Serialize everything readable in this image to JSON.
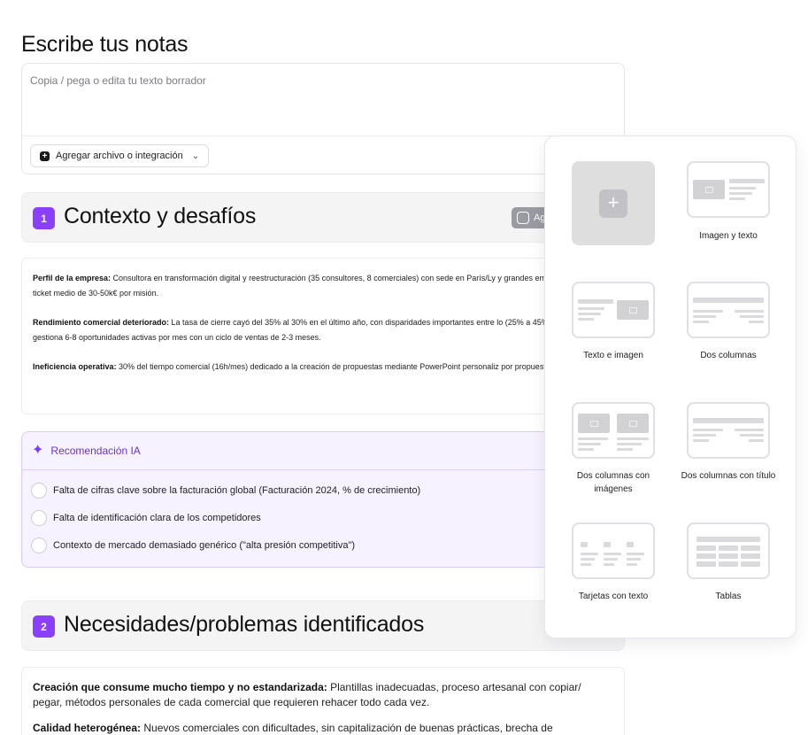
{
  "page_title": "Escribe tus notas",
  "notes": {
    "placeholder": "Copia / pega o edita tu texto borrador",
    "attach_label": "Agregar archivo o integración",
    "attach_icon": "plus-square-icon",
    "attach_chevron": "⌄"
  },
  "section1": {
    "number": "1",
    "title": "Contexto y desafíos",
    "ai_button_label": "Ag",
    "paragraphs": [
      {
        "bold": "Perfil de la empresa:",
        "text": " Consultora en transformación digital y reestructuración (35 consultores, 8 comerciales) con sede en París/Ly y grandes empresas con un ticket medio de 30-50k€ por misión."
      },
      {
        "bold": "Rendimiento comercial deteriorado:",
        "text": " La tasa de cierre cayó del 35% al 30% en el último año, con disparidades importantes entre lo (25% a 45%). Cada comercial gestiona 6-8 oportunidades activas por mes con un ciclo de ventas de 2-3 meses."
      },
      {
        "bold": "Ineficiencia operativa:",
        "text": " 30% del tiempo comercial (16h/mes) dedicado a la creación de propuestas mediante PowerPoint personaliz por propuesta en promedio."
      }
    ]
  },
  "recommendation": {
    "title": "Recomendación IA",
    "icon": "sparkle-icon",
    "items": [
      "Falta de cifras clave sobre la facturación global (Facturación 2024, % de crecimiento)",
      "Falta de identificación clara de los competidores",
      "Contexto de mercado demasiado genérico (\"alta presión competitiva\")"
    ]
  },
  "section2": {
    "number": "2",
    "title": "Necesidades/problemas identificados",
    "paragraphs": [
      {
        "bold": "Creación que consume mucho tiempo y no estandarizada:",
        "text": " Plantillas inadecuadas, proceso artesanal con copiar/ pegar, métodos personales de cada comercial que requieren rehacer todo cada vez."
      },
      {
        "bold": "Calidad heterogénea:",
        "text": " Nuevos comerciales con dificultades, sin capitalización de buenas prácticas, brecha de"
      }
    ]
  },
  "layout_picker": {
    "add_symbol": "+",
    "tiles": [
      {
        "label": ""
      },
      {
        "label": "Imagen y texto"
      },
      {
        "label": "Texto e imagen"
      },
      {
        "label": "Dos columnas"
      },
      {
        "label": "Dos columnas con imágenes"
      },
      {
        "label": "Dos columnas con título"
      },
      {
        "label": "Tarjetas con texto"
      },
      {
        "label": "Tablas"
      }
    ]
  }
}
